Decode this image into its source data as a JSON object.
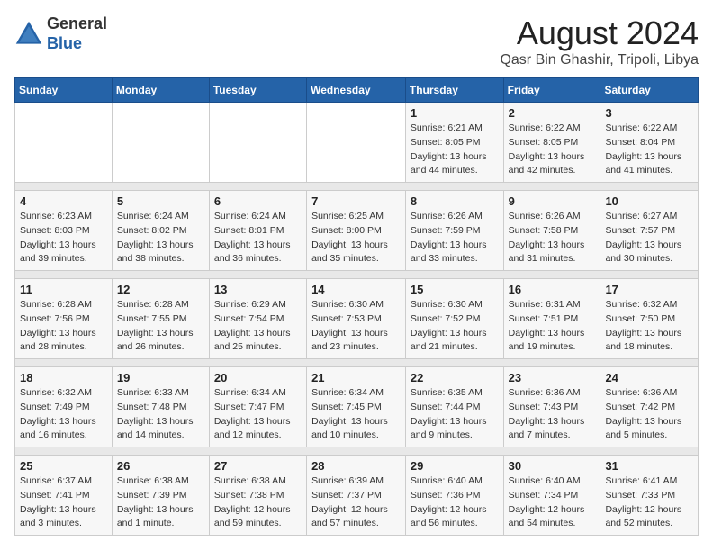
{
  "header": {
    "logo_general": "General",
    "logo_blue": "Blue",
    "month_year": "August 2024",
    "location": "Qasr Bin Ghashir, Tripoli, Libya"
  },
  "days_of_week": [
    "Sunday",
    "Monday",
    "Tuesday",
    "Wednesday",
    "Thursday",
    "Friday",
    "Saturday"
  ],
  "weeks": [
    {
      "days": [
        {
          "num": "",
          "info": ""
        },
        {
          "num": "",
          "info": ""
        },
        {
          "num": "",
          "info": ""
        },
        {
          "num": "",
          "info": ""
        },
        {
          "num": "1",
          "info": "Sunrise: 6:21 AM\nSunset: 8:05 PM\nDaylight: 13 hours\nand 44 minutes."
        },
        {
          "num": "2",
          "info": "Sunrise: 6:22 AM\nSunset: 8:05 PM\nDaylight: 13 hours\nand 42 minutes."
        },
        {
          "num": "3",
          "info": "Sunrise: 6:22 AM\nSunset: 8:04 PM\nDaylight: 13 hours\nand 41 minutes."
        }
      ]
    },
    {
      "days": [
        {
          "num": "4",
          "info": "Sunrise: 6:23 AM\nSunset: 8:03 PM\nDaylight: 13 hours\nand 39 minutes."
        },
        {
          "num": "5",
          "info": "Sunrise: 6:24 AM\nSunset: 8:02 PM\nDaylight: 13 hours\nand 38 minutes."
        },
        {
          "num": "6",
          "info": "Sunrise: 6:24 AM\nSunset: 8:01 PM\nDaylight: 13 hours\nand 36 minutes."
        },
        {
          "num": "7",
          "info": "Sunrise: 6:25 AM\nSunset: 8:00 PM\nDaylight: 13 hours\nand 35 minutes."
        },
        {
          "num": "8",
          "info": "Sunrise: 6:26 AM\nSunset: 7:59 PM\nDaylight: 13 hours\nand 33 minutes."
        },
        {
          "num": "9",
          "info": "Sunrise: 6:26 AM\nSunset: 7:58 PM\nDaylight: 13 hours\nand 31 minutes."
        },
        {
          "num": "10",
          "info": "Sunrise: 6:27 AM\nSunset: 7:57 PM\nDaylight: 13 hours\nand 30 minutes."
        }
      ]
    },
    {
      "days": [
        {
          "num": "11",
          "info": "Sunrise: 6:28 AM\nSunset: 7:56 PM\nDaylight: 13 hours\nand 28 minutes."
        },
        {
          "num": "12",
          "info": "Sunrise: 6:28 AM\nSunset: 7:55 PM\nDaylight: 13 hours\nand 26 minutes."
        },
        {
          "num": "13",
          "info": "Sunrise: 6:29 AM\nSunset: 7:54 PM\nDaylight: 13 hours\nand 25 minutes."
        },
        {
          "num": "14",
          "info": "Sunrise: 6:30 AM\nSunset: 7:53 PM\nDaylight: 13 hours\nand 23 minutes."
        },
        {
          "num": "15",
          "info": "Sunrise: 6:30 AM\nSunset: 7:52 PM\nDaylight: 13 hours\nand 21 minutes."
        },
        {
          "num": "16",
          "info": "Sunrise: 6:31 AM\nSunset: 7:51 PM\nDaylight: 13 hours\nand 19 minutes."
        },
        {
          "num": "17",
          "info": "Sunrise: 6:32 AM\nSunset: 7:50 PM\nDaylight: 13 hours\nand 18 minutes."
        }
      ]
    },
    {
      "days": [
        {
          "num": "18",
          "info": "Sunrise: 6:32 AM\nSunset: 7:49 PM\nDaylight: 13 hours\nand 16 minutes."
        },
        {
          "num": "19",
          "info": "Sunrise: 6:33 AM\nSunset: 7:48 PM\nDaylight: 13 hours\nand 14 minutes."
        },
        {
          "num": "20",
          "info": "Sunrise: 6:34 AM\nSunset: 7:47 PM\nDaylight: 13 hours\nand 12 minutes."
        },
        {
          "num": "21",
          "info": "Sunrise: 6:34 AM\nSunset: 7:45 PM\nDaylight: 13 hours\nand 10 minutes."
        },
        {
          "num": "22",
          "info": "Sunrise: 6:35 AM\nSunset: 7:44 PM\nDaylight: 13 hours\nand 9 minutes."
        },
        {
          "num": "23",
          "info": "Sunrise: 6:36 AM\nSunset: 7:43 PM\nDaylight: 13 hours\nand 7 minutes."
        },
        {
          "num": "24",
          "info": "Sunrise: 6:36 AM\nSunset: 7:42 PM\nDaylight: 13 hours\nand 5 minutes."
        }
      ]
    },
    {
      "days": [
        {
          "num": "25",
          "info": "Sunrise: 6:37 AM\nSunset: 7:41 PM\nDaylight: 13 hours\nand 3 minutes."
        },
        {
          "num": "26",
          "info": "Sunrise: 6:38 AM\nSunset: 7:39 PM\nDaylight: 13 hours\nand 1 minute."
        },
        {
          "num": "27",
          "info": "Sunrise: 6:38 AM\nSunset: 7:38 PM\nDaylight: 12 hours\nand 59 minutes."
        },
        {
          "num": "28",
          "info": "Sunrise: 6:39 AM\nSunset: 7:37 PM\nDaylight: 12 hours\nand 57 minutes."
        },
        {
          "num": "29",
          "info": "Sunrise: 6:40 AM\nSunset: 7:36 PM\nDaylight: 12 hours\nand 56 minutes."
        },
        {
          "num": "30",
          "info": "Sunrise: 6:40 AM\nSunset: 7:34 PM\nDaylight: 12 hours\nand 54 minutes."
        },
        {
          "num": "31",
          "info": "Sunrise: 6:41 AM\nSunset: 7:33 PM\nDaylight: 12 hours\nand 52 minutes."
        }
      ]
    }
  ]
}
